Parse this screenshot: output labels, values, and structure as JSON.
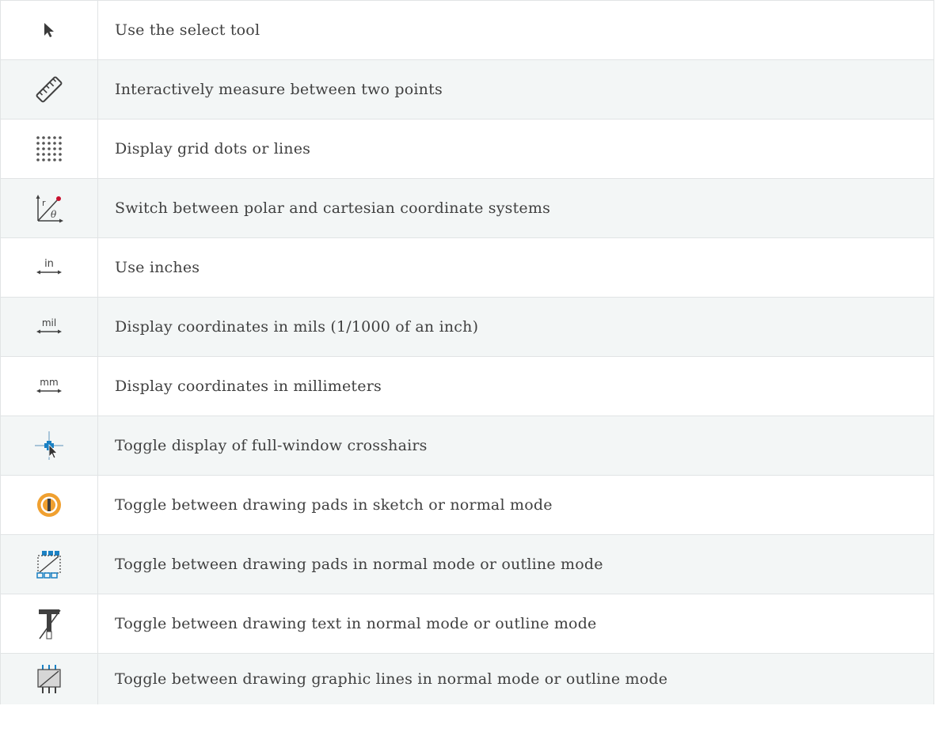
{
  "rows": [
    {
      "icon": "select-arrow-icon",
      "text": "Use the select tool"
    },
    {
      "icon": "ruler-measure-icon",
      "text": "Interactively measure between two points"
    },
    {
      "icon": "grid-dots-icon",
      "text": "Display grid dots or lines"
    },
    {
      "icon": "polar-coordinates-icon",
      "text": "Switch between polar and cartesian coordinate systems"
    },
    {
      "icon": "units-inches-icon",
      "text": "Use inches"
    },
    {
      "icon": "units-mils-icon",
      "text": "Display coordinates in mils (1/1000 of an inch)"
    },
    {
      "icon": "units-mm-icon",
      "text": "Display coordinates in millimeters"
    },
    {
      "icon": "crosshairs-icon",
      "text": "Toggle display of full-window crosshairs"
    },
    {
      "icon": "pad-sketch-mode-icon",
      "text": "Toggle between drawing pads in sketch or normal mode"
    },
    {
      "icon": "pad-outline-mode-icon",
      "text": "Toggle between drawing pads in normal mode or outline mode"
    },
    {
      "icon": "text-outline-mode-icon",
      "text": "Toggle between drawing text in normal mode or outline mode"
    },
    {
      "icon": "graphic-lines-outline-mode-icon",
      "text": "Toggle between drawing graphic lines in normal mode or outline mode"
    }
  ],
  "icon_labels": {
    "polar_r": "r",
    "polar_theta": "θ",
    "inches": "in",
    "mils": "mil",
    "mm": "mm"
  },
  "colors": {
    "text": "#404040",
    "border": "#e1e4e5",
    "stripe": "#f3f6f6",
    "icon_dark": "#404040",
    "icon_blue": "#1a81c4",
    "icon_orange": "#f0a030",
    "icon_red": "#c8102e"
  }
}
